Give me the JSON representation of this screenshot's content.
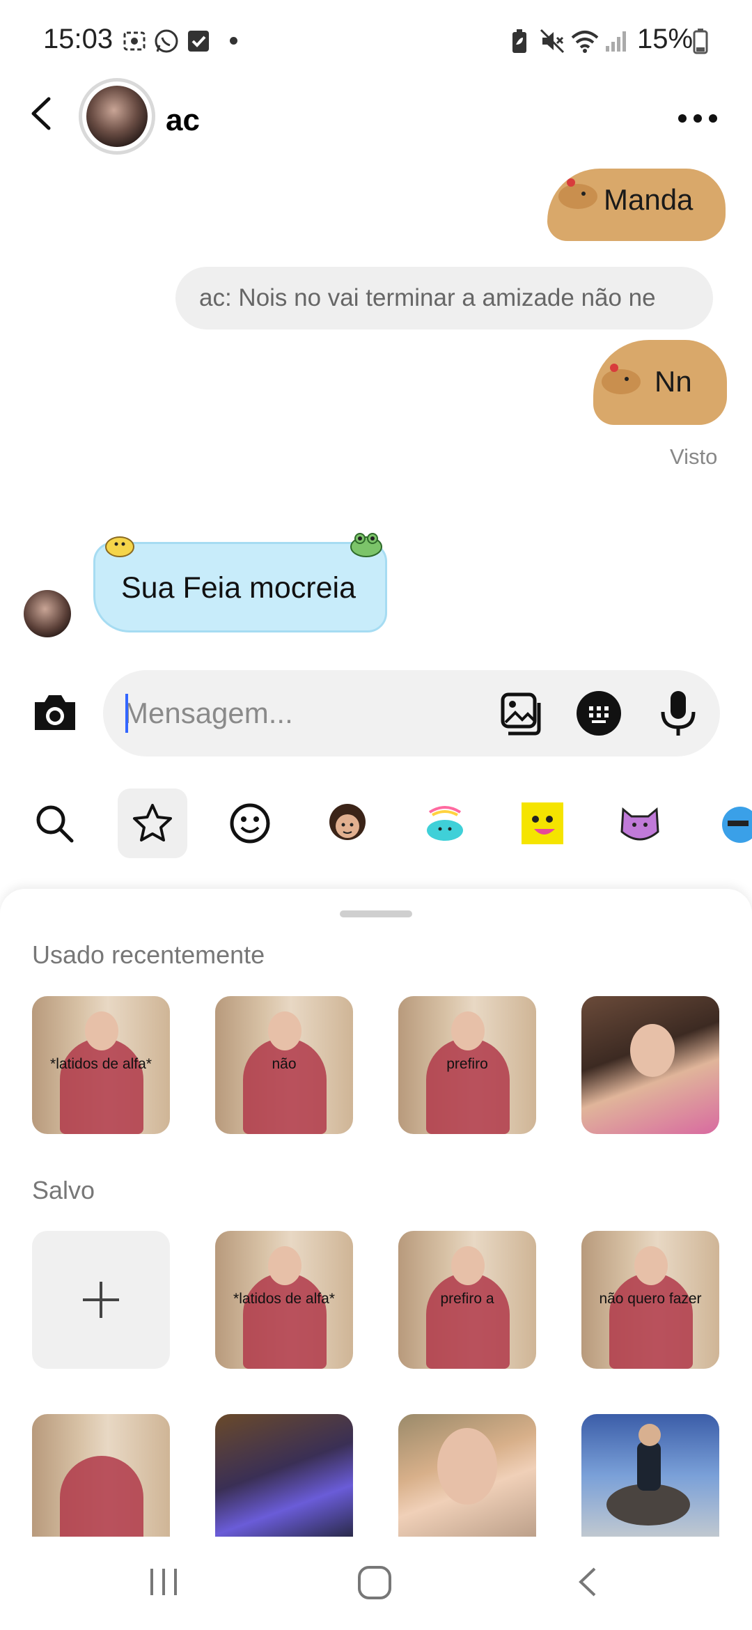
{
  "status_bar": {
    "time": "15:03",
    "battery": "15%"
  },
  "header": {
    "contact_name": "ac"
  },
  "messages": {
    "sticker_1_text": "Manda",
    "reply_preview": "ac: Nois no vai terminar a amizade não ne",
    "sticker_2_text": "Nn",
    "seen": "Visto",
    "incoming_text": "Sua Feia mocreia"
  },
  "composer": {
    "placeholder": "Mensagem..."
  },
  "panel": {
    "recent_title": "Usado recentemente",
    "saved_title": "Salvo",
    "recent_captions": [
      "*latidos de alfa*",
      "não",
      "prefiro",
      ""
    ],
    "saved_captions": [
      "",
      "*latidos de alfa*",
      "prefiro a",
      "não quero fazer"
    ]
  },
  "icons": {
    "tabs": [
      "search-icon",
      "star-icon",
      "smiley-icon",
      "avatar-sticker-icon",
      "cloud-sticker-icon",
      "face-sticker-icon",
      "cat-sticker-icon",
      "blob-sticker-icon"
    ]
  }
}
